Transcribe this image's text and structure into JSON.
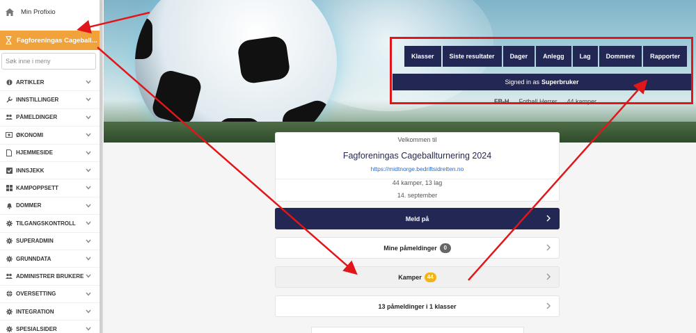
{
  "sidebar": {
    "home_label": "Min Profixio",
    "active_label": "Fagforeningas Cageball...",
    "search_placeholder": "Søk inne i meny",
    "items": [
      {
        "label": "ARTIKLER",
        "icon": "info-icon"
      },
      {
        "label": "INNSTILLINGER",
        "icon": "wrench-icon"
      },
      {
        "label": "PÅMELDINGER",
        "icon": "users-icon"
      },
      {
        "label": "ØKONOMI",
        "icon": "money-icon"
      },
      {
        "label": "HJEMMESIDE",
        "icon": "file-icon"
      },
      {
        "label": "INNSJEKK",
        "icon": "checkbox-icon"
      },
      {
        "label": "KAMPOPPSETT",
        "icon": "grid-icon"
      },
      {
        "label": "DOMMER",
        "icon": "bell-icon"
      },
      {
        "label": "TILGANGSKONTROLL",
        "icon": "gear-icon"
      },
      {
        "label": "SUPERADMIN",
        "icon": "gear-icon"
      },
      {
        "label": "GRUNNDATA",
        "icon": "gear-icon"
      },
      {
        "label": "ADMINISTRER BRUKERE",
        "icon": "users-icon"
      },
      {
        "label": "OVERSETTING",
        "icon": "globe-icon"
      },
      {
        "label": "INTEGRATION",
        "icon": "gear-icon"
      },
      {
        "label": "SPESIALSIDER",
        "icon": "gear-icon"
      }
    ]
  },
  "topnav": {
    "buttons": [
      "Klasser",
      "Siste resultater",
      "Dager",
      "Anlegg",
      "Lag",
      "Dommere",
      "Rapporter"
    ],
    "signed_in_prefix": "Signed in as",
    "signed_in_user": "Superbruker",
    "info_code": "FB-H",
    "info_name": "Fotball Herrer",
    "info_matches": "44 kamper"
  },
  "event": {
    "welcome": "Velkommen til",
    "title": "Fagforeningas Cageballturnering 2024",
    "url": "https://midtnorge.bedriftsidretten.no",
    "summary": "44 kamper, 13 lag",
    "date": "14. september"
  },
  "actions": {
    "register": "Meld på",
    "my_registrations": "Mine påmeldinger",
    "my_registrations_count": "0",
    "matches": "Kamper",
    "matches_count": "44",
    "registrations_summary": "13 påmeldinger i 1 klasser"
  },
  "colors": {
    "navy": "#232754",
    "accent_orange": "#f2a23a",
    "badge_orange": "#f2b314",
    "annotation_red": "#e0161a"
  }
}
